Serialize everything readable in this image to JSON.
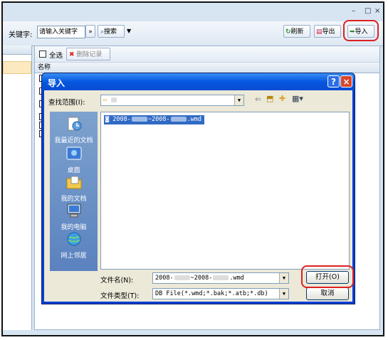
{
  "app": {
    "window_controls": [
      "–",
      "□",
      "×"
    ],
    "keyword_label": "关键字:",
    "search_placeholder": "请输入关键字",
    "nav_button": "»",
    "search_button": "搜索",
    "dropdown": "▼",
    "refresh_button": "刷新",
    "export_button": "导出",
    "import_button": "导入",
    "select_all_label": "全选",
    "delete_button": "删除记录",
    "name_column": "名称"
  },
  "dialog": {
    "title": "导入",
    "help_button": "?",
    "close_button": "×",
    "lookin_label": "查找范围(I):",
    "lookin_value": "",
    "places": [
      {
        "label": "我最近的文档",
        "icon": "recent-docs-icon"
      },
      {
        "label": "桌面",
        "icon": "desktop-icon"
      },
      {
        "label": "我的文档",
        "icon": "my-documents-icon"
      },
      {
        "label": "我的电脑",
        "icon": "my-computer-icon"
      },
      {
        "label": "网上邻居",
        "icon": "network-places-icon"
      }
    ],
    "file_item": {
      "prefix": "2008-",
      "mid": "~2008-",
      "suffix": ".wmd"
    },
    "filename_label": "文件名(N):",
    "filename_value": {
      "prefix": "2008-",
      "mid": "~2008-",
      "suffix": ".wmd"
    },
    "filetype_label": "文件类型(T):",
    "filetype_value": "DB File(*.wmd;*.bak;*.atb;*.db)",
    "open_button": "打开(O)",
    "cancel_button": "取消"
  },
  "colors": {
    "highlight_red": "#d22222",
    "title_blue": "#0558e0",
    "selection_blue": "#316ac5"
  }
}
